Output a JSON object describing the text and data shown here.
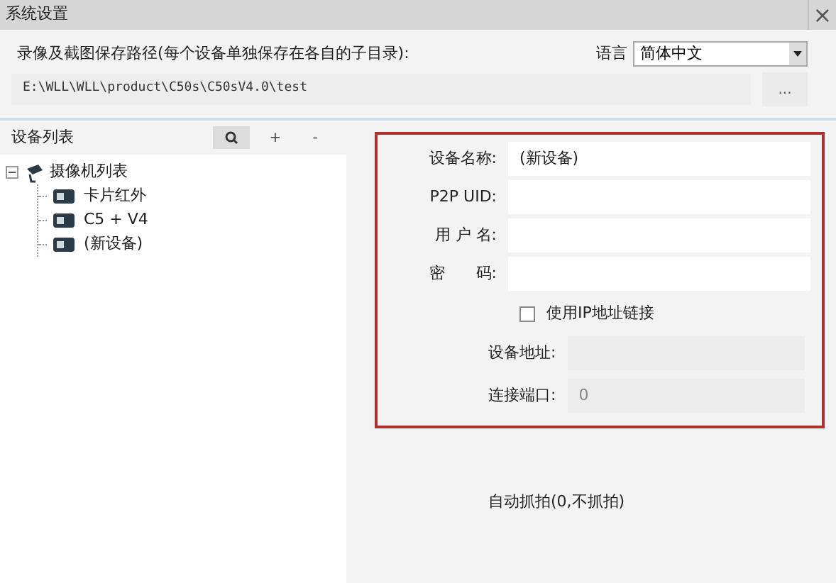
{
  "window": {
    "title": "系统设置",
    "close": "×"
  },
  "path": {
    "label": "录像及截图保存路径(每个设备单独保存在各自的子目录):",
    "value": "E:\\WLL\\WLL\\product\\C50s\\C50sV4.0\\test",
    "browse": "..."
  },
  "language": {
    "label": "语言",
    "value": "简体中文"
  },
  "device_list": {
    "title": "设备列表",
    "buttons": [
      "+",
      "-"
    ],
    "tree": {
      "label": "摄像机列表",
      "expanded": true,
      "children": [
        {
          "label": "卡片红外",
          "selected": false
        },
        {
          "label": "C5 + V4",
          "selected": false
        },
        {
          "label": "(新设备)",
          "selected": false
        }
      ]
    }
  },
  "form": {
    "fields": [
      {
        "label": "设备名称:",
        "value": "(新设备)",
        "disabled": false
      },
      {
        "label": "P2P UID:",
        "disabled": false
      },
      {
        "label": "用 户 名:",
        "disabled": false
      },
      {
        "label": "密　　码:",
        "disabled": false
      }
    ],
    "use_ip": {
      "label": "使用IP地址链接",
      "checked": false
    },
    "ip_fields": [
      {
        "label": "设备地址:",
        "disabled": true
      },
      {
        "label": "连接端口:",
        "value": "0",
        "disabled": true
      }
    ]
  },
  "auto_capture": {
    "label": "自动抓拍(0,不抓拍)"
  }
}
